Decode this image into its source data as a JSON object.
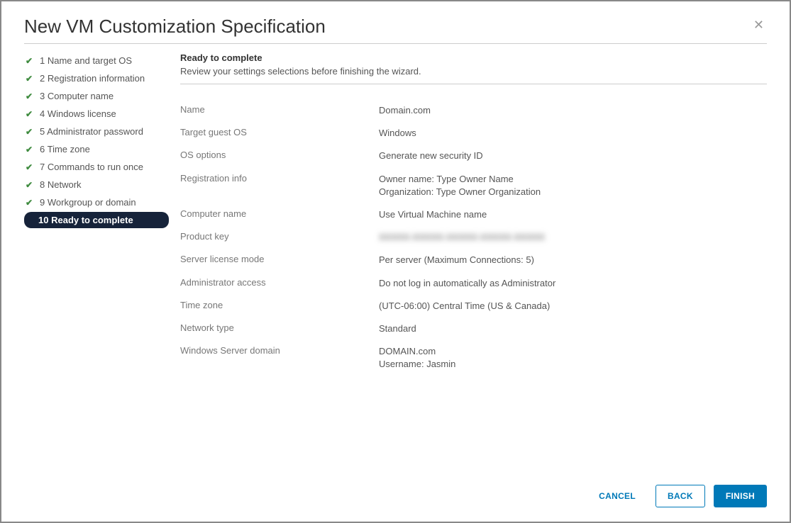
{
  "dialog": {
    "title": "New VM Customization Specification",
    "close": "✕"
  },
  "steps": [
    {
      "num": "1",
      "label": "Name and target OS"
    },
    {
      "num": "2",
      "label": "Registration information"
    },
    {
      "num": "3",
      "label": "Computer name"
    },
    {
      "num": "4",
      "label": "Windows license"
    },
    {
      "num": "5",
      "label": "Administrator password"
    },
    {
      "num": "6",
      "label": "Time zone"
    },
    {
      "num": "7",
      "label": "Commands to run once"
    },
    {
      "num": "8",
      "label": "Network"
    },
    {
      "num": "9",
      "label": "Workgroup or domain"
    },
    {
      "num": "10",
      "label": "Ready to complete"
    }
  ],
  "content": {
    "heading": "Ready to complete",
    "subheading": "Review your settings selections before finishing the wizard."
  },
  "summary": {
    "name_label": "Name",
    "name_value": "Domain.com",
    "os_label": "Target guest OS",
    "os_value": "Windows",
    "osopt_label": "OS options",
    "osopt_value": "Generate new security ID",
    "reg_label": "Registration info",
    "reg_value": "Owner name: Type Owner Name\nOrganization: Type Owner Organization",
    "comp_label": "Computer name",
    "comp_value": "Use Virtual Machine name",
    "key_label": "Product key",
    "key_value": "XXXXX-XXXXX-XXXXX-XXXXX-XXXXX",
    "lic_label": "Server license mode",
    "lic_value": "Per server (Maximum Connections: 5)",
    "admin_label": "Administrator access",
    "admin_value": "Do not log in automatically as Administrator",
    "tz_label": "Time zone",
    "tz_value": "(UTC-06:00) Central Time (US & Canada)",
    "net_label": "Network type",
    "net_value": "Standard",
    "dom_label": "Windows Server domain",
    "dom_value": "DOMAIN.com\nUsername: Jasmin"
  },
  "footer": {
    "cancel": "CANCEL",
    "back": "BACK",
    "finish": "FINISH"
  }
}
